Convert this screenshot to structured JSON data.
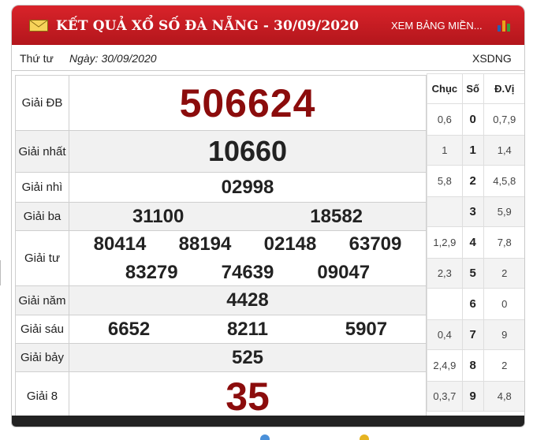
{
  "header": {
    "title": "KẾT QUẢ XỔ SỐ ĐÀ NẴNG - 30/09/2020",
    "link_label": "XEM BẢNG MIỀN...",
    "icons": [
      "mail-icon",
      "bar-chart-icon"
    ],
    "accent_color": "#c8161d"
  },
  "subbar": {
    "weekday": "Thứ tư",
    "date": "Ngày: 30/09/2020",
    "code": "XSDNG"
  },
  "results": {
    "db": {
      "label": "Giải ĐB",
      "numbers": [
        "506624"
      ]
    },
    "nhat": {
      "label": "Giải nhất",
      "numbers": [
        "10660"
      ]
    },
    "nhi": {
      "label": "Giải nhì",
      "numbers": [
        "02998"
      ]
    },
    "ba": {
      "label": "Giải ba",
      "numbers": [
        "31100",
        "18582"
      ]
    },
    "tu": {
      "label": "Giải tư",
      "numbers": [
        "80414",
        "88194",
        "02148",
        "63709",
        "83279",
        "74639",
        "09047"
      ]
    },
    "nam": {
      "label": "Giải năm",
      "numbers": [
        "4428"
      ]
    },
    "sau": {
      "label": "Giải sáu",
      "numbers": [
        "6652",
        "8211",
        "5907"
      ]
    },
    "bay": {
      "label": "Giải bảy",
      "numbers": [
        "525"
      ]
    },
    "tam": {
      "label": "Giải 8",
      "numbers": [
        "35"
      ]
    },
    "highlight_color": "#8b0c0c"
  },
  "loto": {
    "headers": {
      "chuc": "Chục",
      "so": "Số",
      "dvi": "Đ.Vị"
    },
    "rows": [
      {
        "chuc": "0,6",
        "so": "0",
        "dvi": "0,7,9"
      },
      {
        "chuc": "1",
        "so": "1",
        "dvi": "1,4"
      },
      {
        "chuc": "5,8",
        "so": "2",
        "dvi": "4,5,8"
      },
      {
        "chuc": "",
        "so": "3",
        "dvi": "5,9"
      },
      {
        "chuc": "1,2,9",
        "so": "4",
        "dvi": "7,8"
      },
      {
        "chuc": "2,3",
        "so": "5",
        "dvi": "2"
      },
      {
        "chuc": "",
        "so": "6",
        "dvi": "0"
      },
      {
        "chuc": "0,4",
        "so": "7",
        "dvi": "9"
      },
      {
        "chuc": "2,4,9",
        "so": "8",
        "dvi": "2"
      },
      {
        "chuc": "0,3,7",
        "so": "9",
        "dvi": "4,8"
      }
    ]
  }
}
